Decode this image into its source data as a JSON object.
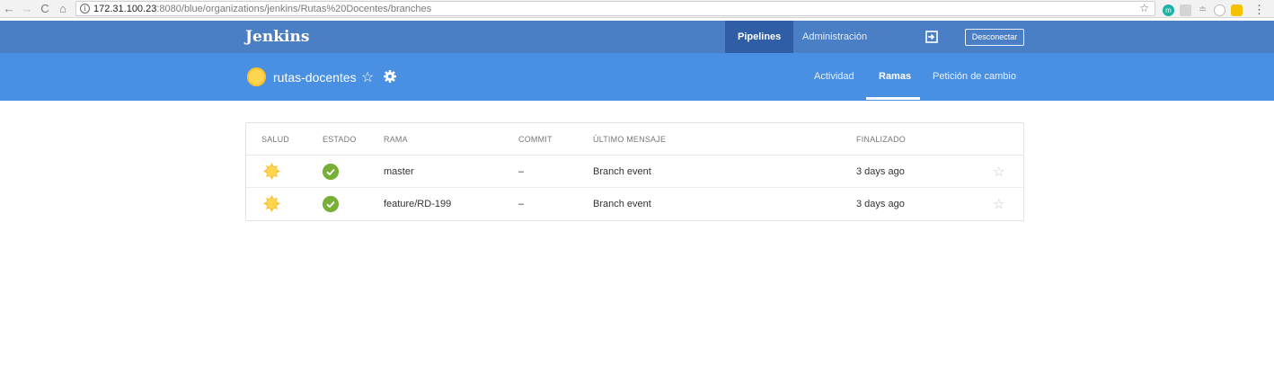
{
  "browser": {
    "back": "←",
    "forward": "→",
    "reload": "C",
    "home": "⌂",
    "url_host": "172.31.100.23",
    "url_rest": ":8080/blue/organizations/jenkins/Rutas%20Docentes/branches",
    "bookmark": "☆"
  },
  "header": {
    "brand": "Jenkins",
    "nav": {
      "pipelines": "Pipelines",
      "admin": "Administración"
    },
    "logout_label": "Desconectar"
  },
  "pipeline": {
    "name": "rutas-docentes",
    "tabs": {
      "activity": "Actividad",
      "branches": "Ramas",
      "pull_requests": "Petición de cambio"
    },
    "active_tab": "branches"
  },
  "table": {
    "headers": {
      "health": "SALUD",
      "status": "ESTADO",
      "branch": "RAMA",
      "commit": "COMMIT",
      "message": "ÚLTIMO MENSAJE",
      "finished": "FINALIZADO"
    },
    "rows": [
      {
        "branch": "master",
        "commit": "–",
        "message": "Branch event",
        "finished": "3 days ago",
        "health_icon": "sunny-weather-icon",
        "status_icon": "success-check-icon"
      },
      {
        "branch": "feature/RD-199",
        "commit": "–",
        "message": "Branch event",
        "finished": "3 days ago",
        "health_icon": "sunny-weather-icon",
        "status_icon": "success-check-icon"
      }
    ]
  },
  "colors": {
    "topbar": "#4a7fc6",
    "subbar": "#4a90e2",
    "active_nav": "#2f5ea6",
    "success": "#78b037",
    "sun": "#ffd54f"
  }
}
